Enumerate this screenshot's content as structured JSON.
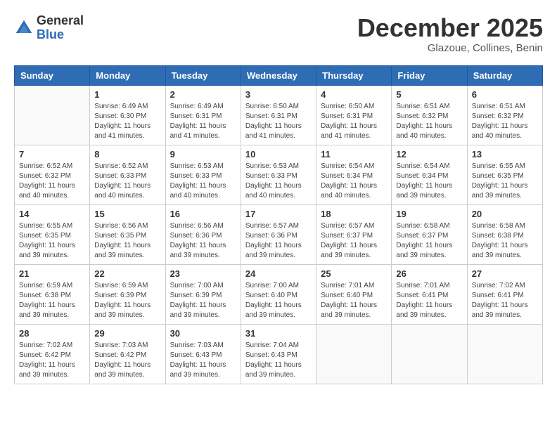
{
  "header": {
    "logo_general": "General",
    "logo_blue": "Blue",
    "month": "December 2025",
    "location": "Glazoue, Collines, Benin"
  },
  "weekdays": [
    "Sunday",
    "Monday",
    "Tuesday",
    "Wednesday",
    "Thursday",
    "Friday",
    "Saturday"
  ],
  "weeks": [
    [
      {
        "day": "",
        "sunrise": "",
        "sunset": "",
        "daylight": ""
      },
      {
        "day": "1",
        "sunrise": "Sunrise: 6:49 AM",
        "sunset": "Sunset: 6:30 PM",
        "daylight": "Daylight: 11 hours and 41 minutes."
      },
      {
        "day": "2",
        "sunrise": "Sunrise: 6:49 AM",
        "sunset": "Sunset: 6:31 PM",
        "daylight": "Daylight: 11 hours and 41 minutes."
      },
      {
        "day": "3",
        "sunrise": "Sunrise: 6:50 AM",
        "sunset": "Sunset: 6:31 PM",
        "daylight": "Daylight: 11 hours and 41 minutes."
      },
      {
        "day": "4",
        "sunrise": "Sunrise: 6:50 AM",
        "sunset": "Sunset: 6:31 PM",
        "daylight": "Daylight: 11 hours and 41 minutes."
      },
      {
        "day": "5",
        "sunrise": "Sunrise: 6:51 AM",
        "sunset": "Sunset: 6:32 PM",
        "daylight": "Daylight: 11 hours and 40 minutes."
      },
      {
        "day": "6",
        "sunrise": "Sunrise: 6:51 AM",
        "sunset": "Sunset: 6:32 PM",
        "daylight": "Daylight: 11 hours and 40 minutes."
      }
    ],
    [
      {
        "day": "7",
        "sunrise": "Sunrise: 6:52 AM",
        "sunset": "Sunset: 6:32 PM",
        "daylight": "Daylight: 11 hours and 40 minutes."
      },
      {
        "day": "8",
        "sunrise": "Sunrise: 6:52 AM",
        "sunset": "Sunset: 6:33 PM",
        "daylight": "Daylight: 11 hours and 40 minutes."
      },
      {
        "day": "9",
        "sunrise": "Sunrise: 6:53 AM",
        "sunset": "Sunset: 6:33 PM",
        "daylight": "Daylight: 11 hours and 40 minutes."
      },
      {
        "day": "10",
        "sunrise": "Sunrise: 6:53 AM",
        "sunset": "Sunset: 6:33 PM",
        "daylight": "Daylight: 11 hours and 40 minutes."
      },
      {
        "day": "11",
        "sunrise": "Sunrise: 6:54 AM",
        "sunset": "Sunset: 6:34 PM",
        "daylight": "Daylight: 11 hours and 40 minutes."
      },
      {
        "day": "12",
        "sunrise": "Sunrise: 6:54 AM",
        "sunset": "Sunset: 6:34 PM",
        "daylight": "Daylight: 11 hours and 39 minutes."
      },
      {
        "day": "13",
        "sunrise": "Sunrise: 6:55 AM",
        "sunset": "Sunset: 6:35 PM",
        "daylight": "Daylight: 11 hours and 39 minutes."
      }
    ],
    [
      {
        "day": "14",
        "sunrise": "Sunrise: 6:55 AM",
        "sunset": "Sunset: 6:35 PM",
        "daylight": "Daylight: 11 hours and 39 minutes."
      },
      {
        "day": "15",
        "sunrise": "Sunrise: 6:56 AM",
        "sunset": "Sunset: 6:35 PM",
        "daylight": "Daylight: 11 hours and 39 minutes."
      },
      {
        "day": "16",
        "sunrise": "Sunrise: 6:56 AM",
        "sunset": "Sunset: 6:36 PM",
        "daylight": "Daylight: 11 hours and 39 minutes."
      },
      {
        "day": "17",
        "sunrise": "Sunrise: 6:57 AM",
        "sunset": "Sunset: 6:36 PM",
        "daylight": "Daylight: 11 hours and 39 minutes."
      },
      {
        "day": "18",
        "sunrise": "Sunrise: 6:57 AM",
        "sunset": "Sunset: 6:37 PM",
        "daylight": "Daylight: 11 hours and 39 minutes."
      },
      {
        "day": "19",
        "sunrise": "Sunrise: 6:58 AM",
        "sunset": "Sunset: 6:37 PM",
        "daylight": "Daylight: 11 hours and 39 minutes."
      },
      {
        "day": "20",
        "sunrise": "Sunrise: 6:58 AM",
        "sunset": "Sunset: 6:38 PM",
        "daylight": "Daylight: 11 hours and 39 minutes."
      }
    ],
    [
      {
        "day": "21",
        "sunrise": "Sunrise: 6:59 AM",
        "sunset": "Sunset: 6:38 PM",
        "daylight": "Daylight: 11 hours and 39 minutes."
      },
      {
        "day": "22",
        "sunrise": "Sunrise: 6:59 AM",
        "sunset": "Sunset: 6:39 PM",
        "daylight": "Daylight: 11 hours and 39 minutes."
      },
      {
        "day": "23",
        "sunrise": "Sunrise: 7:00 AM",
        "sunset": "Sunset: 6:39 PM",
        "daylight": "Daylight: 11 hours and 39 minutes."
      },
      {
        "day": "24",
        "sunrise": "Sunrise: 7:00 AM",
        "sunset": "Sunset: 6:40 PM",
        "daylight": "Daylight: 11 hours and 39 minutes."
      },
      {
        "day": "25",
        "sunrise": "Sunrise: 7:01 AM",
        "sunset": "Sunset: 6:40 PM",
        "daylight": "Daylight: 11 hours and 39 minutes."
      },
      {
        "day": "26",
        "sunrise": "Sunrise: 7:01 AM",
        "sunset": "Sunset: 6:41 PM",
        "daylight": "Daylight: 11 hours and 39 minutes."
      },
      {
        "day": "27",
        "sunrise": "Sunrise: 7:02 AM",
        "sunset": "Sunset: 6:41 PM",
        "daylight": "Daylight: 11 hours and 39 minutes."
      }
    ],
    [
      {
        "day": "28",
        "sunrise": "Sunrise: 7:02 AM",
        "sunset": "Sunset: 6:42 PM",
        "daylight": "Daylight: 11 hours and 39 minutes."
      },
      {
        "day": "29",
        "sunrise": "Sunrise: 7:03 AM",
        "sunset": "Sunset: 6:42 PM",
        "daylight": "Daylight: 11 hours and 39 minutes."
      },
      {
        "day": "30",
        "sunrise": "Sunrise: 7:03 AM",
        "sunset": "Sunset: 6:43 PM",
        "daylight": "Daylight: 11 hours and 39 minutes."
      },
      {
        "day": "31",
        "sunrise": "Sunrise: 7:04 AM",
        "sunset": "Sunset: 6:43 PM",
        "daylight": "Daylight: 11 hours and 39 minutes."
      },
      {
        "day": "",
        "sunrise": "",
        "sunset": "",
        "daylight": ""
      },
      {
        "day": "",
        "sunrise": "",
        "sunset": "",
        "daylight": ""
      },
      {
        "day": "",
        "sunrise": "",
        "sunset": "",
        "daylight": ""
      }
    ]
  ]
}
